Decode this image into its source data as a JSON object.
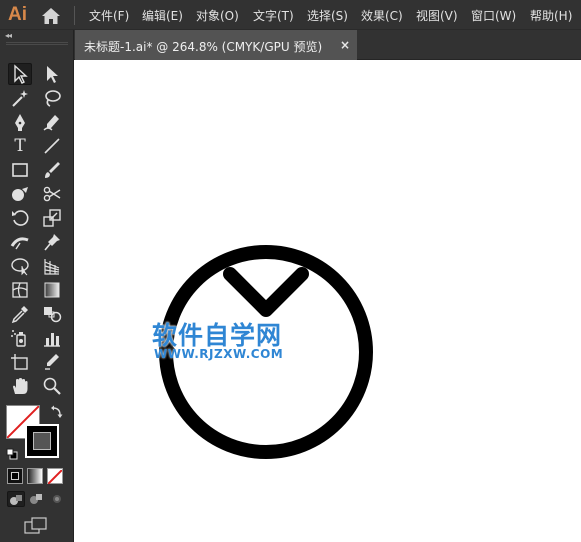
{
  "app": {
    "logo": "Ai",
    "accent_color": "#d7884a"
  },
  "menu": {
    "items": [
      {
        "label": "文件(F)"
      },
      {
        "label": "编辑(E)"
      },
      {
        "label": "对象(O)"
      },
      {
        "label": "文字(T)"
      },
      {
        "label": "选择(S)"
      },
      {
        "label": "效果(C)"
      },
      {
        "label": "视图(V)"
      },
      {
        "label": "窗口(W)"
      },
      {
        "label": "帮助(H)"
      }
    ]
  },
  "tools_panel": {
    "collapse_glyph": "◂◂",
    "tools": [
      {
        "icon": "selection-tool-icon"
      },
      {
        "icon": "direct-selection-tool-icon"
      },
      {
        "icon": "magic-wand-tool-icon"
      },
      {
        "icon": "lasso-tool-icon"
      },
      {
        "icon": "pen-tool-icon"
      },
      {
        "icon": "curvature-tool-icon"
      },
      {
        "icon": "type-tool-icon",
        "glyph": "T"
      },
      {
        "icon": "line-segment-tool-icon"
      },
      {
        "icon": "rectangle-tool-icon"
      },
      {
        "icon": "paintbrush-tool-icon"
      },
      {
        "icon": "shaper-tool-icon"
      },
      {
        "icon": "scissors-tool-icon"
      },
      {
        "icon": "rotate-tool-icon"
      },
      {
        "icon": "scale-tool-icon"
      },
      {
        "icon": "width-tool-icon"
      },
      {
        "icon": "puppet-warp-tool-icon"
      },
      {
        "icon": "shape-builder-tool-icon"
      },
      {
        "icon": "perspective-grid-tool-icon"
      },
      {
        "icon": "mesh-tool-icon"
      },
      {
        "icon": "gradient-tool-icon"
      },
      {
        "icon": "eyedropper-tool-icon"
      },
      {
        "icon": "blend-tool-icon"
      },
      {
        "icon": "symbol-sprayer-tool-icon"
      },
      {
        "icon": "column-graph-tool-icon"
      },
      {
        "icon": "artboard-tool-icon"
      },
      {
        "icon": "slice-tool-icon"
      },
      {
        "icon": "hand-tool-icon"
      },
      {
        "icon": "zoom-tool-icon"
      }
    ],
    "fill_color": "#ffffff",
    "stroke_color": "#000000"
  },
  "document": {
    "tab_title": "未标题-1.ai* @ 264.8% (CMYK/GPU 预览)",
    "close_glyph": "×"
  },
  "watermark": {
    "title": "软件自学网",
    "url": "WWW.RJZXW.COM",
    "color": "#2f86d4"
  }
}
